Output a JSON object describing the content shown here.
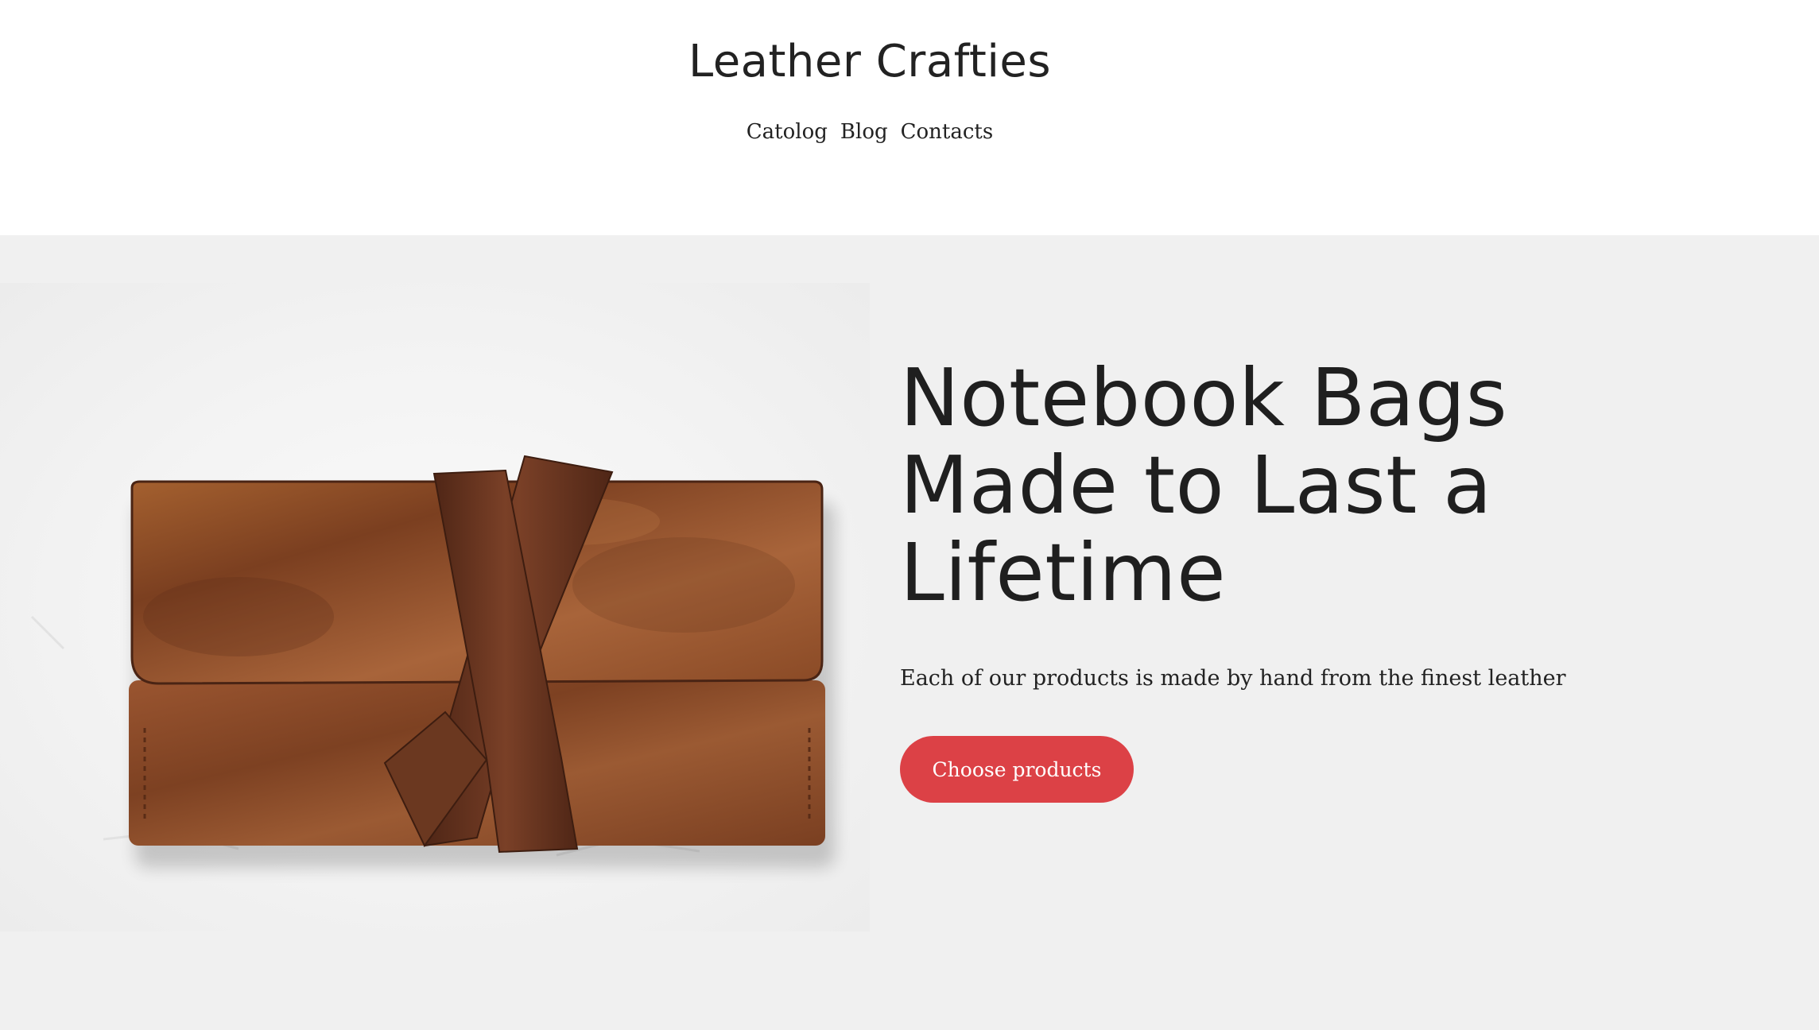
{
  "header": {
    "brand": "Leather Crafties",
    "nav": [
      {
        "label": "Catolog"
      },
      {
        "label": "Blog"
      },
      {
        "label": "Contacts"
      }
    ]
  },
  "hero": {
    "title_lines": [
      "Notebook Bags",
      "Made to Last a",
      "Lifetime"
    ],
    "subtitle": "Each of our products is made by hand from the finest leather",
    "cta_label": "Choose products",
    "image_subject": "brown leather notebook bag with crossed strap"
  },
  "colors": {
    "hero_background": "#f0f0f0",
    "cta_background": "#dc4146",
    "text": "#222222",
    "leather": "#8a4a26"
  }
}
